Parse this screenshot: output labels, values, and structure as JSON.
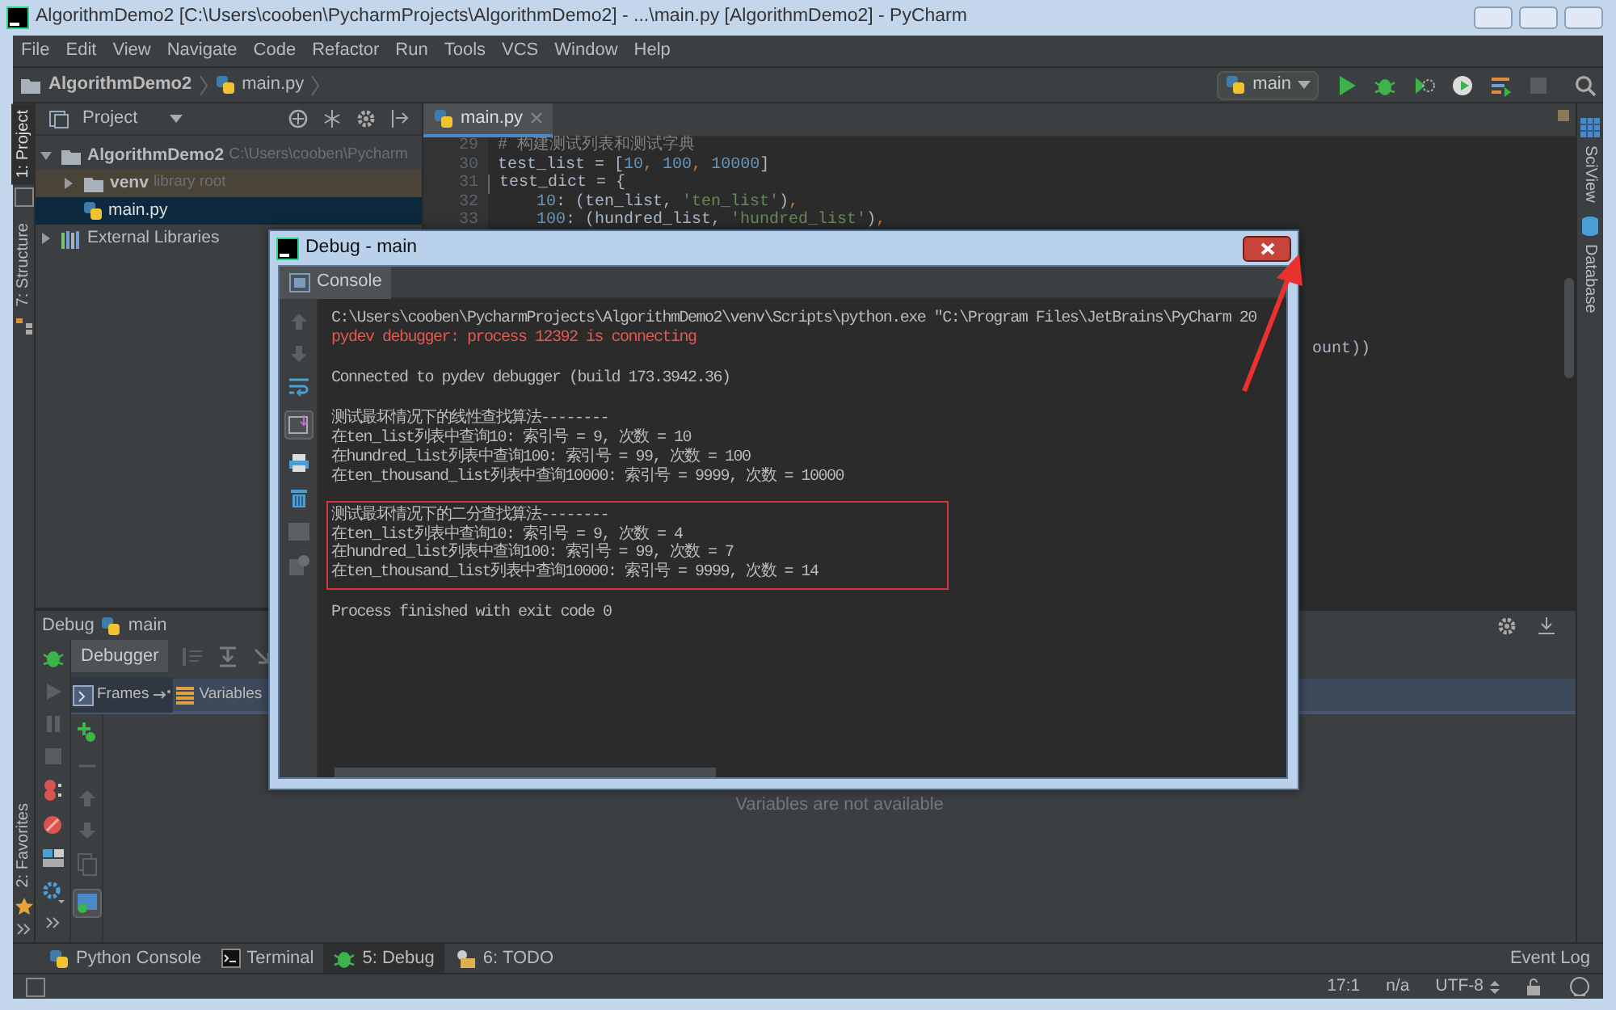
{
  "window": {
    "title": "AlgorithmDemo2 [C:\\Users\\cooben\\PycharmProjects\\AlgorithmDemo2] - ...\\main.py [AlgorithmDemo2] - PyCharm"
  },
  "menu": [
    "File",
    "Edit",
    "View",
    "Navigate",
    "Code",
    "Refactor",
    "Run",
    "Tools",
    "VCS",
    "Window",
    "Help"
  ],
  "breadcrumbs": [
    "AlgorithmDemo2",
    "main.py"
  ],
  "run_config": {
    "label": "main"
  },
  "left_strip": [
    {
      "label": "1: Project",
      "selected": true
    },
    {
      "label": "7: Structure",
      "selected": false
    }
  ],
  "favorites": {
    "label": "2: Favorites",
    "selected": false
  },
  "right_strip": [
    {
      "label": "SciView",
      "kind": "sciview"
    },
    {
      "label": "Database",
      "kind": "database"
    }
  ],
  "project_panel": {
    "title": "Project",
    "tree": [
      {
        "label": "AlgorithmDemo2",
        "hint": "C:\\Users\\cooben\\Pycharm",
        "kind": "project",
        "expanded": true,
        "selected": false,
        "children": [
          {
            "label": "venv",
            "hint": "library root",
            "kind": "library-root",
            "expanded": false,
            "selected": false
          },
          {
            "label": "main.py",
            "kind": "python-file",
            "selected": true
          }
        ]
      },
      {
        "label": "External Libraries",
        "kind": "libraries",
        "expanded": false,
        "selected": false
      }
    ]
  },
  "editor": {
    "tabs": [
      {
        "label": "main.py",
        "selected": true
      }
    ],
    "lines": [
      {
        "number": "29",
        "segments": [
          {
            "text": "# 构建测试列表和测试字典",
            "kind": "comment"
          }
        ]
      },
      {
        "number": "30",
        "segments": [
          {
            "text": "test_list = [",
            "kind": "plain"
          },
          {
            "text": "10",
            "kind": "number"
          },
          {
            "text": ", ",
            "kind": "punct"
          },
          {
            "text": "100",
            "kind": "number"
          },
          {
            "text": ", ",
            "kind": "punct"
          },
          {
            "text": "10000",
            "kind": "number"
          },
          {
            "text": "]",
            "kind": "plain"
          }
        ]
      },
      {
        "number": "31",
        "fold": true,
        "segments": [
          {
            "text": "test_dict = {",
            "kind": "plain"
          }
        ]
      },
      {
        "number": "32",
        "indent": true,
        "segments": [
          {
            "text": "10",
            "kind": "number"
          },
          {
            "text": ": (ten_list, ",
            "kind": "plain"
          },
          {
            "text": "'ten_list'",
            "kind": "string"
          },
          {
            "text": ")",
            "kind": "plain"
          },
          {
            "text": ",",
            "kind": "punct"
          }
        ]
      },
      {
        "number": "33",
        "indent": true,
        "segments": [
          {
            "text": "100",
            "kind": "number"
          },
          {
            "text": ": (hundred_list, ",
            "kind": "plain"
          },
          {
            "text": "'hundred_list'",
            "kind": "string"
          },
          {
            "text": ")",
            "kind": "plain"
          },
          {
            "text": ",",
            "kind": "punct"
          }
        ]
      }
    ],
    "hidden_line_tail": "ount))"
  },
  "debug_panel": {
    "title": "Debug",
    "config": "main",
    "tabs": [
      {
        "label": "Debugger",
        "selected": true
      }
    ],
    "subtabs": [
      {
        "label": "Frames",
        "selected": true
      },
      {
        "label": "Variables",
        "selected": false
      }
    ],
    "empty_message": "Variables are not available"
  },
  "bottom_tabs": [
    {
      "label": "Python Console",
      "kind": "python",
      "selected": false
    },
    {
      "label": "Terminal",
      "kind": "terminal",
      "selected": false
    },
    {
      "label": "5: Debug",
      "kind": "debug",
      "selected": true
    },
    {
      "label": "6: TODO",
      "kind": "todo",
      "selected": false
    }
  ],
  "event_log": "Event Log",
  "status_bar": {
    "position": "17:1",
    "line_separator": "n/a",
    "encoding": "UTF-8"
  },
  "dialog": {
    "title": "Debug - main",
    "tabs": [
      {
        "label": "Console",
        "selected": true
      }
    ],
    "blocks": [
      {
        "highlighted": false,
        "lines": [
          {
            "text": "C:\\Users\\cooben\\PycharmProjects\\AlgorithmDemo2\\venv\\Scripts\\python.exe \"C:\\Program Files\\JetBrains\\PyCharm 20",
            "kind": "normal"
          },
          {
            "text": "pydev debugger: process 12392 is connecting",
            "kind": "error"
          }
        ]
      },
      {
        "highlighted": false,
        "lines": [
          {
            "text": "Connected to pydev debugger (build 173.3942.36)",
            "kind": "normal"
          }
        ]
      },
      {
        "highlighted": false,
        "lines": [
          {
            "text": "测试最坏情况下的线性查找算法--------",
            "kind": "normal"
          },
          {
            "text": "在ten_list列表中查询10: 索引号 = 9, 次数 = 10",
            "kind": "normal"
          },
          {
            "text": "在hundred_list列表中查询100: 索引号 = 99, 次数 = 100",
            "kind": "normal"
          },
          {
            "text": "在ten_thousand_list列表中查询10000: 索引号 = 9999, 次数 = 10000",
            "kind": "normal"
          }
        ]
      },
      {
        "highlighted": true,
        "lines": [
          {
            "text": "测试最坏情况下的二分查找算法--------",
            "kind": "normal"
          },
          {
            "text": "在ten_list列表中查询10: 索引号 = 9, 次数 = 4",
            "kind": "normal"
          },
          {
            "text": "在hundred_list列表中查询100: 索引号 = 99, 次数 = 7",
            "kind": "normal"
          },
          {
            "text": "在ten_thousand_list列表中查询10000: 索引号 = 9999, 次数 = 14",
            "kind": "normal"
          }
        ]
      },
      {
        "highlighted": false,
        "lines": [
          {
            "text": "Process finished with exit code 0",
            "kind": "normal"
          }
        ]
      }
    ]
  }
}
